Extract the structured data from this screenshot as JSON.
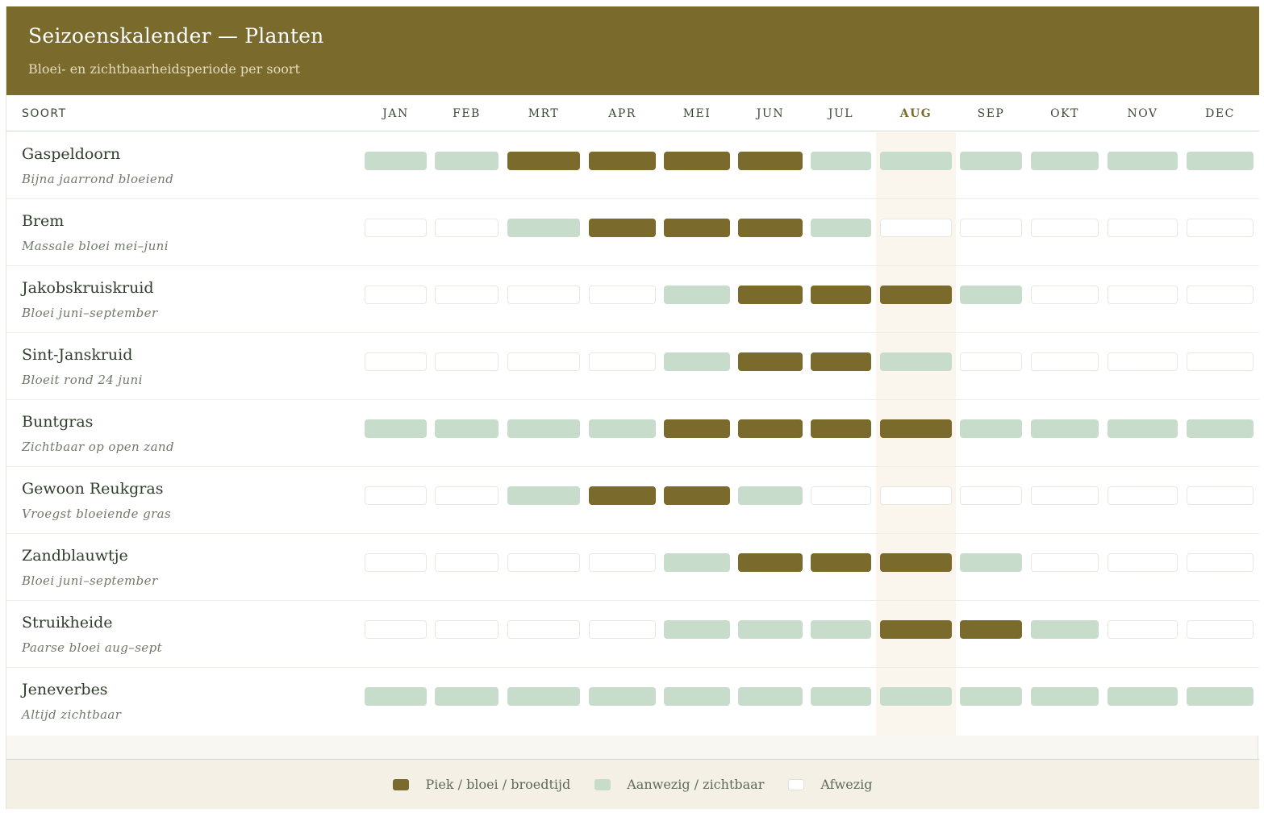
{
  "header": {
    "title": "Seizoenskalender — Planten",
    "subtitle": "Bloei- en zichtbaarheidsperiode per soort"
  },
  "table": {
    "species_header": "SOORT",
    "months": [
      "JAN",
      "FEB",
      "MRT",
      "APR",
      "MEI",
      "JUN",
      "JUL",
      "AUG",
      "SEP",
      "OKT",
      "NOV",
      "DEC"
    ],
    "current_month": "AUG",
    "rows": [
      {
        "name": "Gaspeldoorn",
        "note": "Bijna jaarrond bloeiend",
        "states": [
          "present",
          "present",
          "peak",
          "peak",
          "peak",
          "peak",
          "present",
          "present",
          "present",
          "present",
          "present",
          "present"
        ]
      },
      {
        "name": "Brem",
        "note": "Massale bloei mei–juni",
        "states": [
          "absent",
          "absent",
          "present",
          "peak",
          "peak",
          "peak",
          "present",
          "absent",
          "absent",
          "absent",
          "absent",
          "absent"
        ]
      },
      {
        "name": "Jakobskruiskruid",
        "note": "Bloei juni–september",
        "states": [
          "absent",
          "absent",
          "absent",
          "absent",
          "present",
          "peak",
          "peak",
          "peak",
          "present",
          "absent",
          "absent",
          "absent"
        ]
      },
      {
        "name": "Sint-Janskruid",
        "note": "Bloeit rond 24 juni",
        "states": [
          "absent",
          "absent",
          "absent",
          "absent",
          "present",
          "peak",
          "peak",
          "present",
          "absent",
          "absent",
          "absent",
          "absent"
        ]
      },
      {
        "name": "Buntgras",
        "note": "Zichtbaar op open zand",
        "states": [
          "present",
          "present",
          "present",
          "present",
          "peak",
          "peak",
          "peak",
          "peak",
          "present",
          "present",
          "present",
          "present"
        ]
      },
      {
        "name": "Gewoon Reukgras",
        "note": "Vroegst bloeiende gras",
        "states": [
          "absent",
          "absent",
          "present",
          "peak",
          "peak",
          "present",
          "absent",
          "absent",
          "absent",
          "absent",
          "absent",
          "absent"
        ]
      },
      {
        "name": "Zandblauwtje",
        "note": "Bloei juni–september",
        "states": [
          "absent",
          "absent",
          "absent",
          "absent",
          "present",
          "peak",
          "peak",
          "peak",
          "present",
          "absent",
          "absent",
          "absent"
        ]
      },
      {
        "name": "Struikheide",
        "note": "Paarse bloei aug–sept",
        "states": [
          "absent",
          "absent",
          "absent",
          "absent",
          "present",
          "present",
          "present",
          "peak",
          "peak",
          "present",
          "absent",
          "absent"
        ]
      },
      {
        "name": "Jeneverbes",
        "note": "Altijd zichtbaar",
        "states": [
          "present",
          "present",
          "present",
          "present",
          "present",
          "present",
          "present",
          "present",
          "present",
          "present",
          "present",
          "present"
        ]
      }
    ]
  },
  "legend": [
    {
      "kind": "peak",
      "label": "Piek / bloei / broedtijd"
    },
    {
      "kind": "present",
      "label": "Aanwezig / zichtbaar"
    },
    {
      "kind": "absent",
      "label": "Afwezig"
    }
  ],
  "colors": {
    "peak": "#7a6a2b",
    "present": "#c7dccb",
    "absent": "#ffffff",
    "header_bg": "#7a6a2b"
  }
}
